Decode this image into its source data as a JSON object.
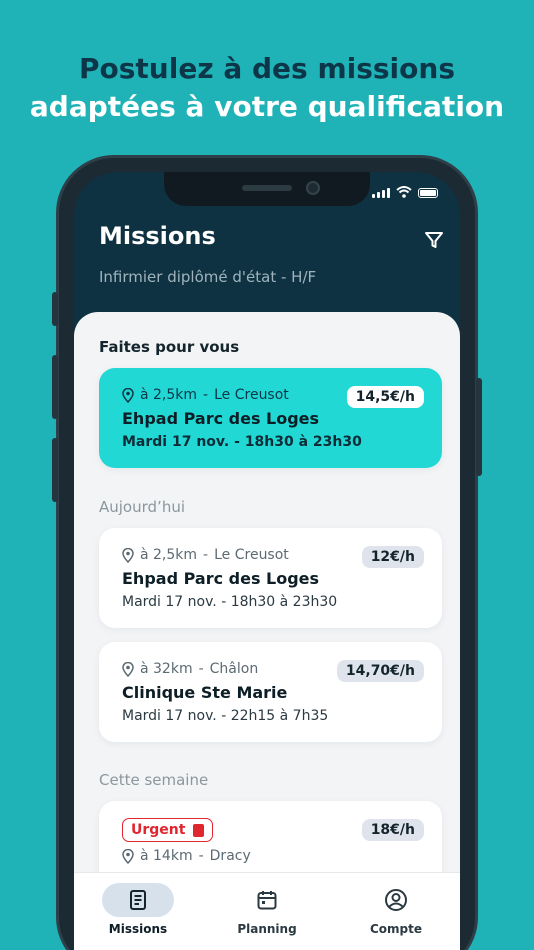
{
  "headline": {
    "line1": "Postulez à des missions",
    "line2": "adaptées à votre qualification"
  },
  "header": {
    "title": "Missions",
    "subtitle": "Infirmier diplômé d'état - H/F",
    "filter_icon": "filter-icon"
  },
  "sections": {
    "featured": "Faites pour vous",
    "today": "Aujourd’hui",
    "week": "Cette semaine"
  },
  "featured_card": {
    "distance": "à 2,5km",
    "city": "Le Creusot",
    "name": "Ehpad Parc des Loges",
    "time": "Mardi 17 nov. - 18h30 à 23h30",
    "price": "14,5€/h"
  },
  "today_cards": [
    {
      "distance": "à 2,5km",
      "city": "Le Creusot",
      "name": "Ehpad Parc des Loges",
      "time": "Mardi 17 nov. - 18h30 à 23h30",
      "price": "12€/h"
    },
    {
      "distance": "à 32km",
      "city": "Châlon",
      "name": "Clinique Ste Marie",
      "time": "Mardi 17 nov. - 22h15 à 7h35",
      "price": "14,70€/h"
    }
  ],
  "week_cards": [
    {
      "badge": "Urgent",
      "distance": "à 14km",
      "city": "Dracy",
      "price": "18€/h"
    }
  ],
  "tabs": [
    {
      "label": "Missions",
      "icon": "document-icon",
      "active": true
    },
    {
      "label": "Planning",
      "icon": "calendar-icon",
      "active": false
    },
    {
      "label": "Compte",
      "icon": "user-circle-icon",
      "active": false
    }
  ],
  "colors": {
    "background": "#1fb2b7",
    "header": "#0f3242",
    "accent": "#21d8d4",
    "urgent": "#e0262e"
  }
}
